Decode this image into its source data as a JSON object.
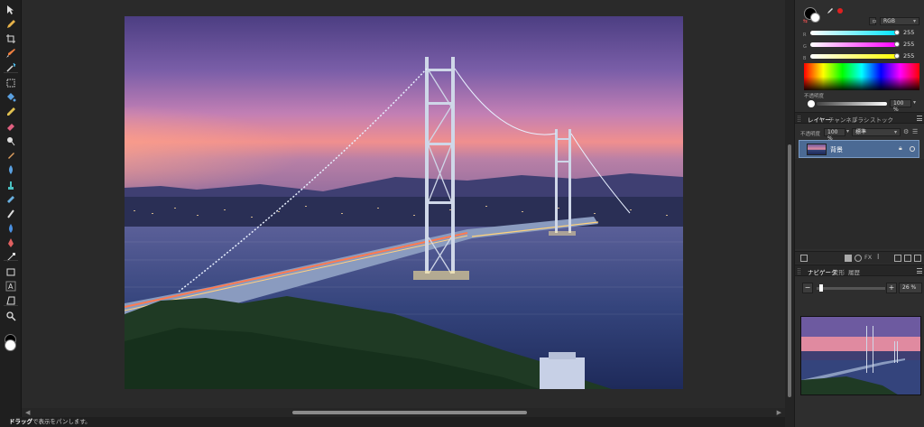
{
  "toolbar": {
    "tools": [
      {
        "name": "move-tool",
        "icon": "pointer-arrow"
      },
      {
        "name": "eyedropper-tool",
        "icon": "eyedropper"
      },
      {
        "name": "crop-tool",
        "icon": "crop"
      },
      {
        "name": "brush-tool",
        "icon": "paint-brush"
      },
      {
        "name": "magic-wand-tool",
        "icon": "magic-wand"
      },
      {
        "name": "selection-tool",
        "icon": "marquee"
      },
      {
        "name": "flood-fill-tool",
        "icon": "paint-bucket"
      },
      {
        "name": "pixel-tool",
        "icon": "pencil"
      },
      {
        "name": "erase-tool",
        "icon": "eraser"
      },
      {
        "name": "dodge-tool",
        "icon": "dodge"
      },
      {
        "name": "burn-tool",
        "icon": "burn"
      },
      {
        "name": "blur-tool",
        "icon": "blur"
      },
      {
        "name": "clone-tool",
        "icon": "stamp"
      },
      {
        "name": "healing-tool",
        "icon": "bandage"
      },
      {
        "name": "smudge-tool",
        "icon": "smudge"
      },
      {
        "name": "sharpen-tool",
        "icon": "drop"
      },
      {
        "name": "pen-tool",
        "icon": "pen"
      },
      {
        "name": "node-tool",
        "icon": "node"
      },
      {
        "name": "rectangle-tool",
        "icon": "rectangle"
      },
      {
        "name": "text-tool",
        "icon": "text-a"
      },
      {
        "name": "perspective-tool",
        "icon": "perspective"
      },
      {
        "name": "zoom-tool",
        "icon": "magnifier"
      }
    ]
  },
  "status": {
    "bold": "ドラッグ",
    "text": "で表示をパンします。"
  },
  "color_panel": {
    "mode": "RGB",
    "channels": [
      {
        "label": "R",
        "value": "255",
        "color": "#00e5ff"
      },
      {
        "label": "G",
        "value": "255",
        "color": "#ff00ff"
      },
      {
        "label": "B",
        "value": "255",
        "color": "#ffff00"
      }
    ],
    "opacity_label": "不透明度",
    "opacity_value": "100 %",
    "accent_red": "#e02020"
  },
  "layers_panel": {
    "tabs": [
      "レイヤー",
      "チャンネル",
      "ブラシ",
      "ストック"
    ],
    "opacity_label": "不透明度",
    "opacity_value": "100 %",
    "blend_mode": "標準",
    "layer_name": "背景",
    "selected_color": "#4b6a94"
  },
  "navigator_panel": {
    "tabs": [
      "ナビゲータ",
      "変形",
      "履歴"
    ],
    "zoom_value": "26 %"
  }
}
